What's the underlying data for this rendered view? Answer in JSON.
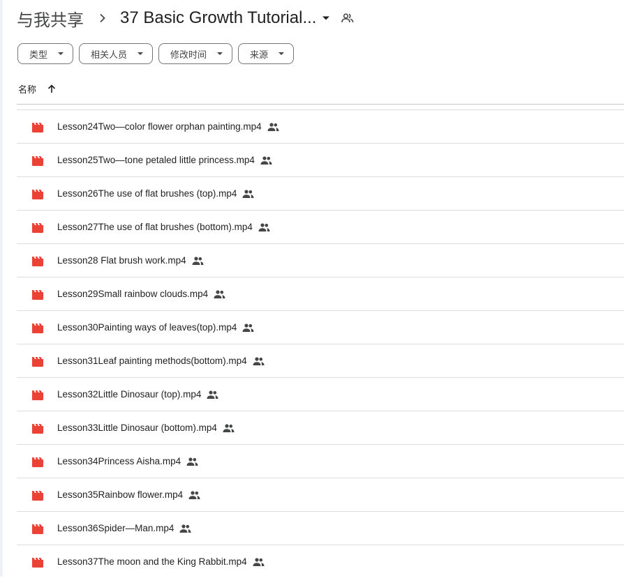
{
  "breadcrumb": {
    "root": "与我共享",
    "current": "37 Basic Growth Tutorial..."
  },
  "filters": [
    {
      "label": "类型"
    },
    {
      "label": "相关人员"
    },
    {
      "label": "修改时间"
    },
    {
      "label": "来源"
    }
  ],
  "list_header": {
    "name_label": "名称",
    "sort": "ascending"
  },
  "icons": {
    "breadcrumb_separator": "chevron-right-icon",
    "title_menu": "caret-down-icon",
    "shared_folder": "people-outline-icon",
    "chip_caret": "caret-down-icon",
    "sort": "arrow-up-icon",
    "file": "video-file-icon",
    "shared": "people-icon"
  },
  "colors": {
    "video_icon": "#ea4335",
    "text_primary": "#1f1f1f",
    "text_secondary": "#444746",
    "divider": "#dadce0"
  },
  "files": [
    {
      "name": "Lesson24Two—color flower orphan painting.mp4"
    },
    {
      "name": "Lesson25Two—tone petaled little princess.mp4"
    },
    {
      "name": "Lesson26The use of flat brushes (top).mp4"
    },
    {
      "name": "Lesson27The use of flat brushes (bottom).mp4"
    },
    {
      "name": "Lesson28 Flat brush work.mp4"
    },
    {
      "name": "Lesson29Small rainbow clouds.mp4"
    },
    {
      "name": "Lesson30Painting ways of leaves(top).mp4"
    },
    {
      "name": "Lesson31Leaf painting methods(bottom).mp4"
    },
    {
      "name": "Lesson32Little Dinosaur (top).mp4"
    },
    {
      "name": "Lesson33Little Dinosaur (bottom).mp4"
    },
    {
      "name": "Lesson34Princess Aisha.mp4"
    },
    {
      "name": "Lesson35Rainbow flower.mp4"
    },
    {
      "name": "Lesson36Spider—Man.mp4"
    },
    {
      "name": "Lesson37The moon and the King Rabbit.mp4"
    }
  ]
}
